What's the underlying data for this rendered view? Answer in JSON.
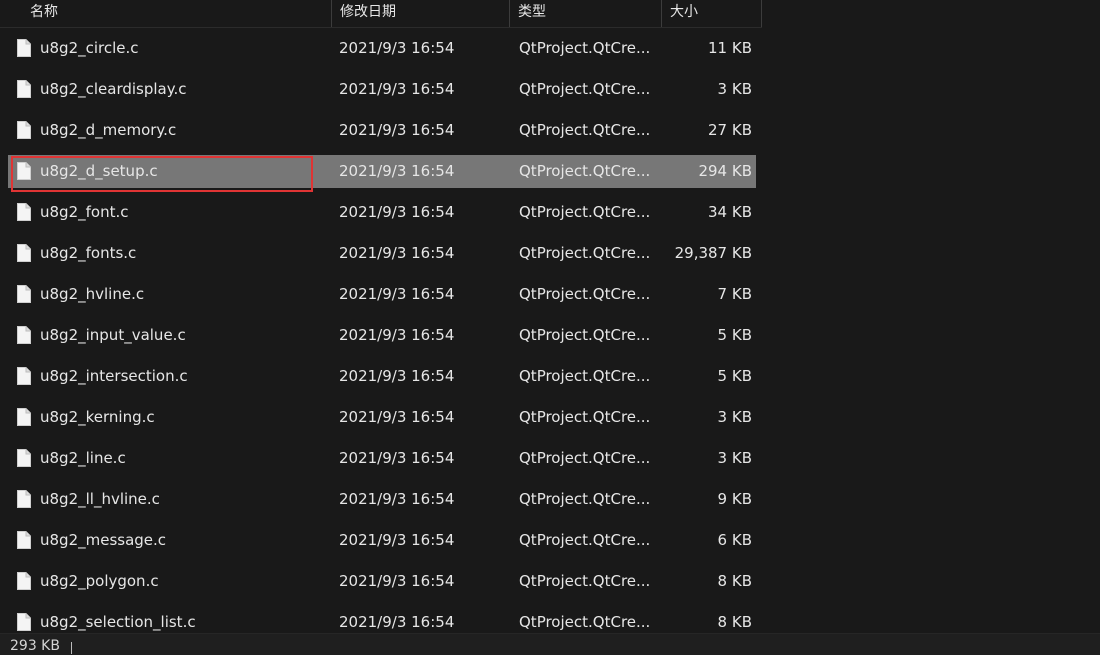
{
  "columns": {
    "name": "名称",
    "date": "修改日期",
    "type": "类型",
    "size": "大小",
    "sort_indicator": "^"
  },
  "files": [
    {
      "name": "u8g2_circle.c",
      "date": "2021/9/3 16:54",
      "type": "QtProject.QtCre...",
      "size": "11 KB"
    },
    {
      "name": "u8g2_cleardisplay.c",
      "date": "2021/9/3 16:54",
      "type": "QtProject.QtCre...",
      "size": "3 KB"
    },
    {
      "name": "u8g2_d_memory.c",
      "date": "2021/9/3 16:54",
      "type": "QtProject.QtCre...",
      "size": "27 KB"
    },
    {
      "name": "u8g2_d_setup.c",
      "date": "2021/9/3 16:54",
      "type": "QtProject.QtCre...",
      "size": "294 KB",
      "selected": true
    },
    {
      "name": "u8g2_font.c",
      "date": "2021/9/3 16:54",
      "type": "QtProject.QtCre...",
      "size": "34 KB"
    },
    {
      "name": "u8g2_fonts.c",
      "date": "2021/9/3 16:54",
      "type": "QtProject.QtCre...",
      "size": "29,387 KB"
    },
    {
      "name": "u8g2_hvline.c",
      "date": "2021/9/3 16:54",
      "type": "QtProject.QtCre...",
      "size": "7 KB"
    },
    {
      "name": "u8g2_input_value.c",
      "date": "2021/9/3 16:54",
      "type": "QtProject.QtCre...",
      "size": "5 KB"
    },
    {
      "name": "u8g2_intersection.c",
      "date": "2021/9/3 16:54",
      "type": "QtProject.QtCre...",
      "size": "5 KB"
    },
    {
      "name": "u8g2_kerning.c",
      "date": "2021/9/3 16:54",
      "type": "QtProject.QtCre...",
      "size": "3 KB"
    },
    {
      "name": "u8g2_line.c",
      "date": "2021/9/3 16:54",
      "type": "QtProject.QtCre...",
      "size": "3 KB"
    },
    {
      "name": "u8g2_ll_hvline.c",
      "date": "2021/9/3 16:54",
      "type": "QtProject.QtCre...",
      "size": "9 KB"
    },
    {
      "name": "u8g2_message.c",
      "date": "2021/9/3 16:54",
      "type": "QtProject.QtCre...",
      "size": "6 KB"
    },
    {
      "name": "u8g2_polygon.c",
      "date": "2021/9/3 16:54",
      "type": "QtProject.QtCre...",
      "size": "8 KB"
    },
    {
      "name": "u8g2_selection_list.c",
      "date": "2021/9/3 16:54",
      "type": "QtProject.QtCre...",
      "size": "8 KB"
    }
  ],
  "status": {
    "selection_size": "293 KB"
  },
  "icons": {
    "file": "file-icon",
    "sort": "sort-up-icon"
  },
  "colors": {
    "background": "#191919",
    "selected_row": "#777777",
    "highlight_box": "#e03434",
    "text": "#e6e6e6"
  }
}
